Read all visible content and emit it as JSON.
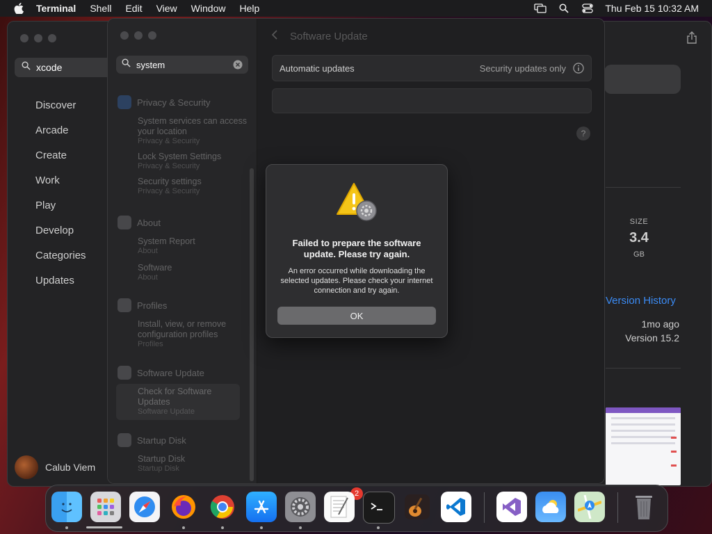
{
  "menubar": {
    "app": "Terminal",
    "menus": [
      "Shell",
      "Edit",
      "View",
      "Window",
      "Help"
    ],
    "clock": "Thu Feb 15  10:32 AM",
    "icons": [
      "apple-icon",
      "screen-mirroring-icon",
      "spotlight-icon",
      "control-center-icon"
    ]
  },
  "appstore": {
    "search_value": "xcode",
    "nav": [
      "Discover",
      "Arcade",
      "Create",
      "Work",
      "Play",
      "Develop",
      "Categories",
      "Updates"
    ],
    "user_name": "Calub Viem",
    "size_label": "SIZE",
    "size_value": "3.4",
    "size_unit": "GB",
    "version_history_link": "Version History",
    "version_time": "1mo ago",
    "version_number": "Version 15.2"
  },
  "settings": {
    "search_value": "system",
    "header_title": "Software Update",
    "auto_updates_label": "Automatic updates",
    "auto_updates_value": "Security updates only",
    "help_label": "?",
    "sidebar": {
      "groups": [
        {
          "header": "Privacy & Security",
          "items": [
            {
              "title": "System services can access your location",
              "sub": "Privacy & Security"
            },
            {
              "title": "Lock System Settings",
              "sub": "Privacy & Security"
            },
            {
              "title": "Security settings",
              "sub": "Privacy & Security"
            }
          ]
        },
        {
          "header": "About",
          "items": [
            {
              "title": "System Report",
              "sub": "About"
            },
            {
              "title": "Software",
              "sub": "About"
            }
          ]
        },
        {
          "header": "Profiles",
          "items": [
            {
              "title": "Install, view, or remove configuration profiles",
              "sub": "Profiles"
            }
          ]
        },
        {
          "header": "Software Update",
          "items": [
            {
              "title": "Check for Software Updates",
              "sub": "Software Update"
            }
          ]
        },
        {
          "header": "Startup Disk",
          "items": [
            {
              "title": "Startup Disk",
              "sub": "Startup Disk"
            }
          ]
        }
      ]
    }
  },
  "alert": {
    "title": "Failed to prepare the software update. Please try again.",
    "message": "An error occurred while downloading the selected updates. Please check your internet connection and try again.",
    "ok_label": "OK"
  },
  "dock": {
    "apps": [
      "Finder",
      "Launchpad",
      "Safari",
      "Firefox",
      "Chrome",
      "App Store",
      "System Settings",
      "TextEdit",
      "Terminal",
      "GarageBand",
      "Visual Studio Code",
      "Visual Studio",
      "Weather",
      "Maps",
      "Trash"
    ],
    "system_settings_badge": "2"
  },
  "colors": {
    "accent_link": "#3b8cf6",
    "badge_red": "#e5392e",
    "warning_yellow": "#f5c518"
  }
}
